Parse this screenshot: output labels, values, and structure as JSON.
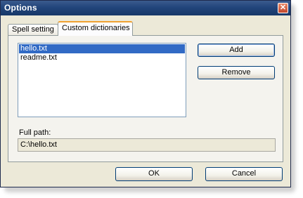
{
  "window": {
    "title": "Options",
    "close_glyph": "✕"
  },
  "tabs": [
    {
      "label": "Spell setting",
      "selected": false
    },
    {
      "label": "Custom dictionaries",
      "selected": true
    }
  ],
  "dictionaries": {
    "items": [
      {
        "label": "hello.txt",
        "selected": true
      },
      {
        "label": "readme.txt",
        "selected": false
      }
    ],
    "add_label": "Add",
    "remove_label": "Remove"
  },
  "full_path": {
    "label": "Full path:",
    "value": "C:\\hello.txt"
  },
  "footer": {
    "ok_label": "OK",
    "cancel_label": "Cancel"
  },
  "colors": {
    "titlebar": "#22457b",
    "selection": "#316ac5",
    "active_tab_accent": "#f0a232",
    "dialog_bg": "#ece9d8"
  }
}
